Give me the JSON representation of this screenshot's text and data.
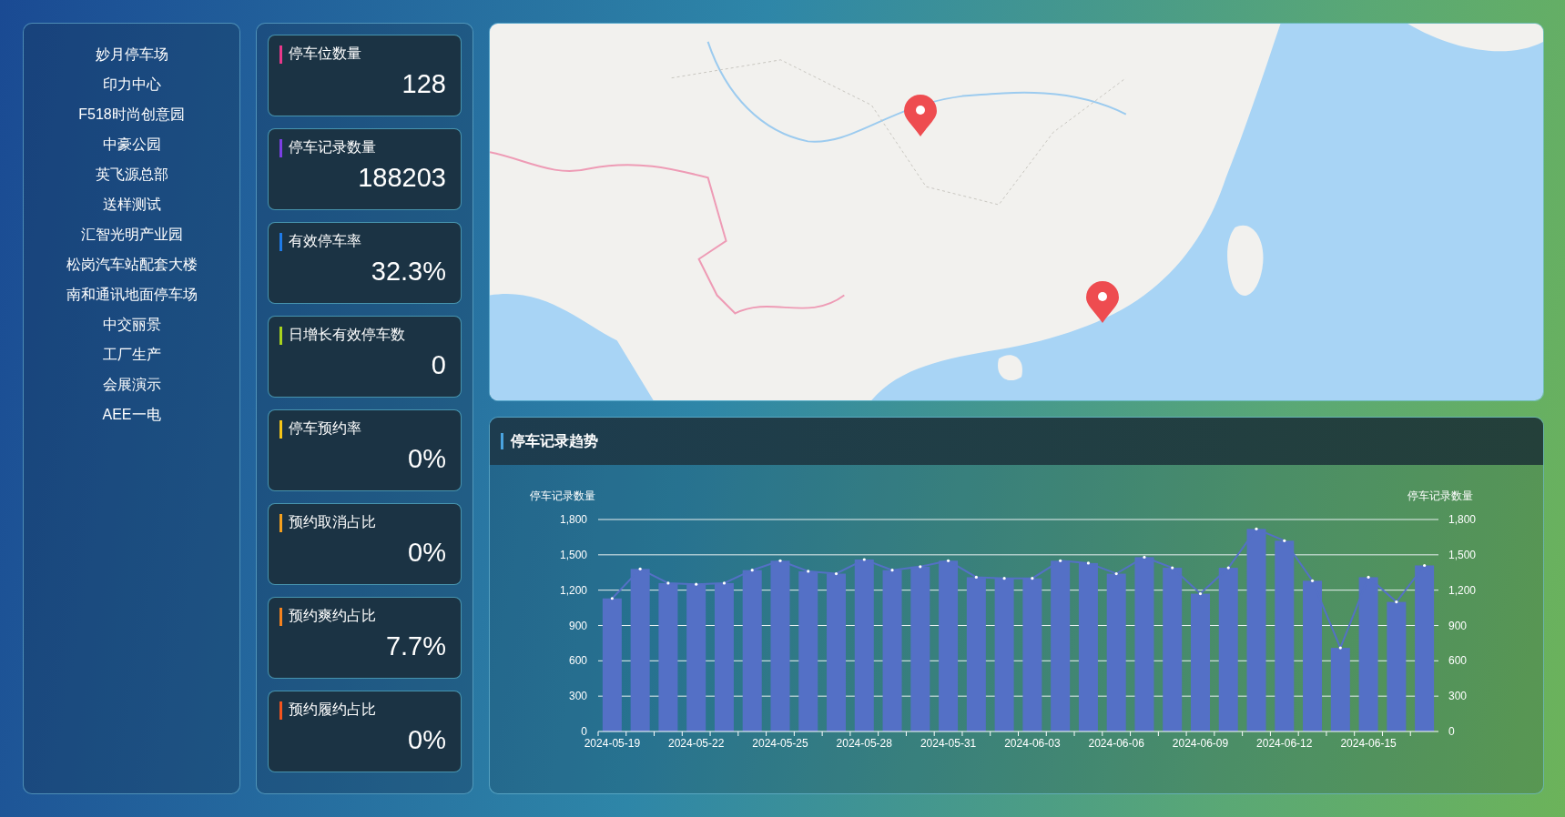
{
  "sidebar": {
    "items": [
      {
        "label": "妙月停车场"
      },
      {
        "label": "印力中心"
      },
      {
        "label": "F518时尚创意园"
      },
      {
        "label": "中豪公园"
      },
      {
        "label": "英飞源总部"
      },
      {
        "label": "送样测试"
      },
      {
        "label": "汇智光明产业园"
      },
      {
        "label": "松岗汽车站配套大楼"
      },
      {
        "label": "南和通讯地面停车场"
      },
      {
        "label": "中交丽景"
      },
      {
        "label": "工厂生产"
      },
      {
        "label": "会展演示"
      },
      {
        "label": "AEE一电"
      }
    ]
  },
  "stats": [
    {
      "label": "停车位数量",
      "value": "128",
      "color": "#e8388a"
    },
    {
      "label": "停车记录数量",
      "value": "188203",
      "color": "#7b3fe4"
    },
    {
      "label": "有效停车率",
      "value": "32.3%",
      "color": "#1e7be8"
    },
    {
      "label": "日增长有效停车数",
      "value": "0",
      "color": "#a8d31e"
    },
    {
      "label": "停车预约率",
      "value": "0%",
      "color": "#f5c518"
    },
    {
      "label": "预约取消占比",
      "value": "0%",
      "color": "#f5a01e"
    },
    {
      "label": "预约爽约占比",
      "value": "7.7%",
      "color": "#f5821e"
    },
    {
      "label": "预约履约占比",
      "value": "0%",
      "color": "#f5541e"
    }
  ],
  "trend": {
    "title": "停车记录趋势",
    "chart_data": {
      "type": "bar",
      "grid": true,
      "ylabel": "停车记录数量",
      "annotations": [
        {
          "text": "停车记录数量"
        }
      ],
      "categories": [
        "2024-05-19",
        null,
        null,
        "2024-05-22",
        null,
        null,
        "2024-05-25",
        null,
        null,
        "2024-05-28",
        null,
        null,
        "2024-05-31",
        null,
        null,
        "2024-06-03",
        null,
        null,
        "2024-06-06",
        null,
        null,
        "2024-06-09",
        null,
        null,
        "2024-06-12",
        null,
        null,
        "2024-06-15",
        null,
        null
      ],
      "ylim": [
        0,
        1800
      ],
      "yticks": [
        {
          "value": 0,
          "label": "0"
        },
        {
          "value": 300,
          "label": "300"
        },
        {
          "value": 600,
          "label": "600"
        },
        {
          "value": 900,
          "label": "900"
        },
        {
          "value": 1200,
          "label": "1,200"
        },
        {
          "value": 1500,
          "label": "1,500"
        },
        {
          "value": 1800,
          "label": "1,800"
        }
      ],
      "series": [
        {
          "type": "bar",
          "color": "#5470c6",
          "values": [
            1130,
            1380,
            1260,
            1250,
            1260,
            1370,
            1450,
            1360,
            1340,
            1460,
            1370,
            1400,
            1450,
            1310,
            1300,
            1300,
            1450,
            1430,
            1340,
            1480,
            1390,
            1170,
            1390,
            1720,
            1620,
            1280,
            710,
            1310,
            1100,
            1410
          ]
        },
        {
          "type": "line",
          "color": "#5470c6",
          "values": [
            1130,
            1380,
            1260,
            1250,
            1260,
            1370,
            1450,
            1360,
            1340,
            1460,
            1370,
            1400,
            1450,
            1310,
            1300,
            1300,
            1450,
            1430,
            1340,
            1480,
            1390,
            1170,
            1390,
            1720,
            1620,
            1280,
            710,
            1310,
            1100,
            1410
          ]
        }
      ]
    }
  }
}
